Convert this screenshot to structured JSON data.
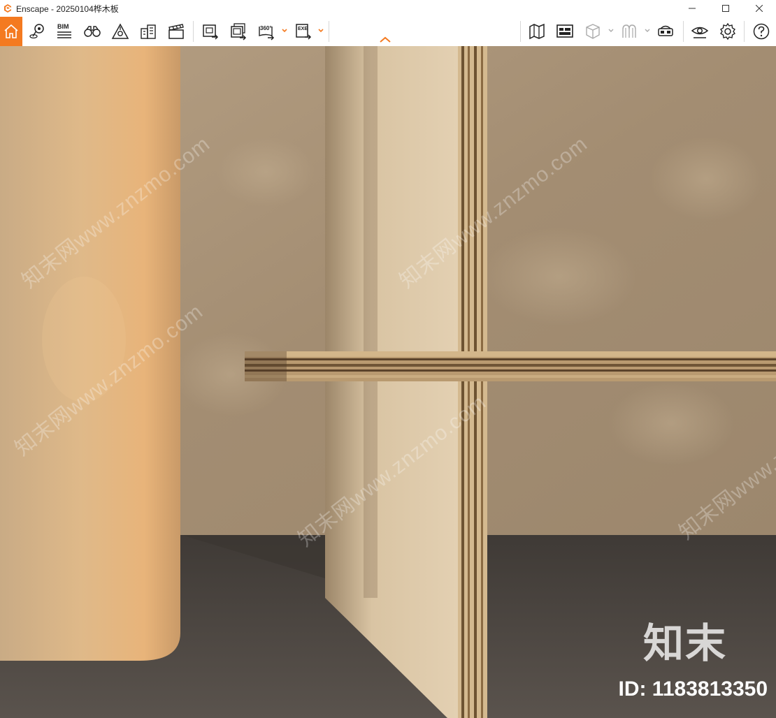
{
  "window": {
    "title": "Enscape - 20250104桦木板",
    "controls": [
      "minimize",
      "maximize",
      "close"
    ]
  },
  "toolbar": {
    "accent_color": "#f47a20",
    "left_tools": [
      {
        "name": "home",
        "icon": "home-icon",
        "active": true
      },
      {
        "name": "location",
        "icon": "map-pin-icon"
      },
      {
        "name": "bim",
        "icon": "bim-icon",
        "label": "BIM"
      },
      {
        "name": "binoculars",
        "icon": "binoculars-icon"
      },
      {
        "name": "atmosphere",
        "icon": "atmosphere-icon"
      },
      {
        "name": "buildings",
        "icon": "buildings-icon"
      },
      {
        "name": "video",
        "icon": "clapperboard-icon"
      },
      {
        "name": "screenshot",
        "icon": "screenshot-icon"
      },
      {
        "name": "batch-render",
        "icon": "batch-render-icon"
      },
      {
        "name": "panorama",
        "icon": "panorama-360-icon",
        "label": "360°"
      },
      {
        "name": "export-exe",
        "icon": "export-exe-icon",
        "label": "EXE"
      }
    ],
    "right_tools": [
      {
        "name": "map",
        "icon": "map-icon"
      },
      {
        "name": "view-management",
        "icon": "view-management-icon"
      },
      {
        "name": "cube-view",
        "icon": "cube-icon"
      },
      {
        "name": "materials",
        "icon": "materials-icon"
      },
      {
        "name": "vr-headset",
        "icon": "vr-headset-icon"
      },
      {
        "name": "visual-settings",
        "icon": "eye-icon"
      },
      {
        "name": "settings",
        "icon": "gear-icon"
      },
      {
        "name": "help",
        "icon": "help-icon"
      }
    ]
  },
  "viewport": {
    "watermark_text": "知末网www.znzmo.com",
    "brand_text": "知末",
    "id_text": "ID: 1183813350"
  }
}
